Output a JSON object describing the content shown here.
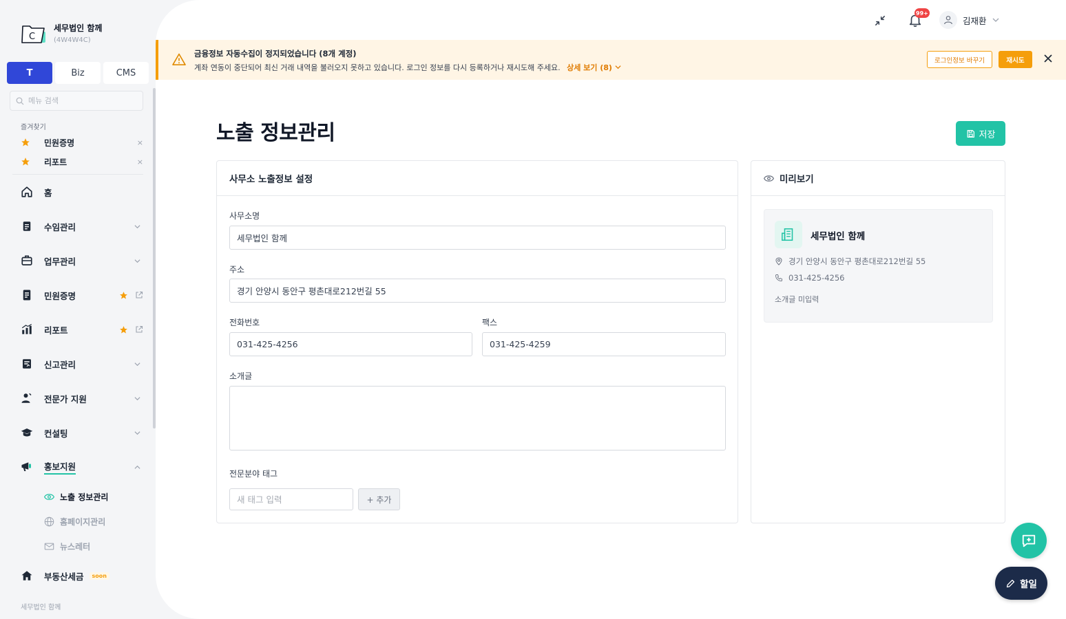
{
  "brand": {
    "name": "세무법인 함께",
    "code": "(4W4W4C)",
    "logo_letter": "C"
  },
  "segments": [
    {
      "label": "T",
      "active": true
    },
    {
      "label": "Biz",
      "active": false
    },
    {
      "label": "CMS",
      "active": false
    }
  ],
  "menu_search": {
    "placeholder": "메뉴 검색"
  },
  "favorites": {
    "title": "즐겨찾기",
    "items": [
      {
        "label": "민원증명"
      },
      {
        "label": "리포트"
      }
    ],
    "remove_symbol": "×"
  },
  "nav": [
    {
      "label": "홈",
      "icon": "home-icon"
    },
    {
      "label": "수임관리",
      "icon": "clipboard-icon"
    },
    {
      "label": "업무관리",
      "icon": "briefcase-icon"
    },
    {
      "label": "민원증명",
      "icon": "document-icon"
    },
    {
      "label": "리포트",
      "icon": "chart-icon"
    },
    {
      "label": "신고관리",
      "icon": "form-icon"
    },
    {
      "label": "전문가 지원",
      "icon": "expert-icon"
    },
    {
      "label": "컨설팅",
      "icon": "graduation-cap-icon"
    },
    {
      "label": "홍보지원",
      "icon": "megaphone-icon",
      "expanded": true
    },
    {
      "label": "부동산세금",
      "icon": "house-icon",
      "badge": "soon"
    }
  ],
  "subnav": [
    {
      "label": "노출 정보관리",
      "icon": "eye-icon",
      "active": true
    },
    {
      "label": "홈페이지관리",
      "icon": "globe-icon",
      "active": false
    },
    {
      "label": "뉴스레터",
      "icon": "mail-icon",
      "active": false
    }
  ],
  "sidebar_footer": "세무법인 함께",
  "topbar": {
    "notification_count": "99+",
    "user_name": "김재환"
  },
  "alert": {
    "title": "금융정보 자동수집이 정지되었습니다 (8개 계정)",
    "description": "계좌 연동이 중단되어 최신 거래 내역을 불러오지 못하고 있습니다. 로그인 정보를 다시 등록하거나 재시도해 주세요.",
    "more_label": "상세 보기 (8)",
    "change_login_label": "로그인정보 바꾸기",
    "retry_label": "재시도",
    "color": "#f59e0b"
  },
  "page": {
    "title": "노출 정보관리",
    "save_label": "저장"
  },
  "form": {
    "card_title": "사무소 노출정보 설정",
    "office_name_label": "사무소명",
    "office_name_value": "세무법인 함께",
    "address_label": "주소",
    "address_value": "경기 안양시 동안구 평촌대로212번길 55",
    "phone_label": "전화번호",
    "phone_value": "031-425-4256",
    "fax_label": "팩스",
    "fax_value": "031-425-4259",
    "intro_label": "소개글",
    "intro_value": "",
    "tags_label": "전문분야 태그",
    "tag_placeholder": "새 태그 입력",
    "tag_add_label": "+ 추가"
  },
  "preview": {
    "card_title": "미리보기",
    "name": "세무법인 함께",
    "address": "경기 안양시 동안구 평촌대로212번길 55",
    "phone": "031-425-4256",
    "intro_empty": "소개글 미입력"
  },
  "fab": {
    "todo_label": "할일"
  },
  "colors": {
    "primary": "#3047d8",
    "accent": "#22c3a6",
    "warning": "#f59e0b",
    "dark": "#1c2b49",
    "favorite_star": "#f59e0b"
  }
}
